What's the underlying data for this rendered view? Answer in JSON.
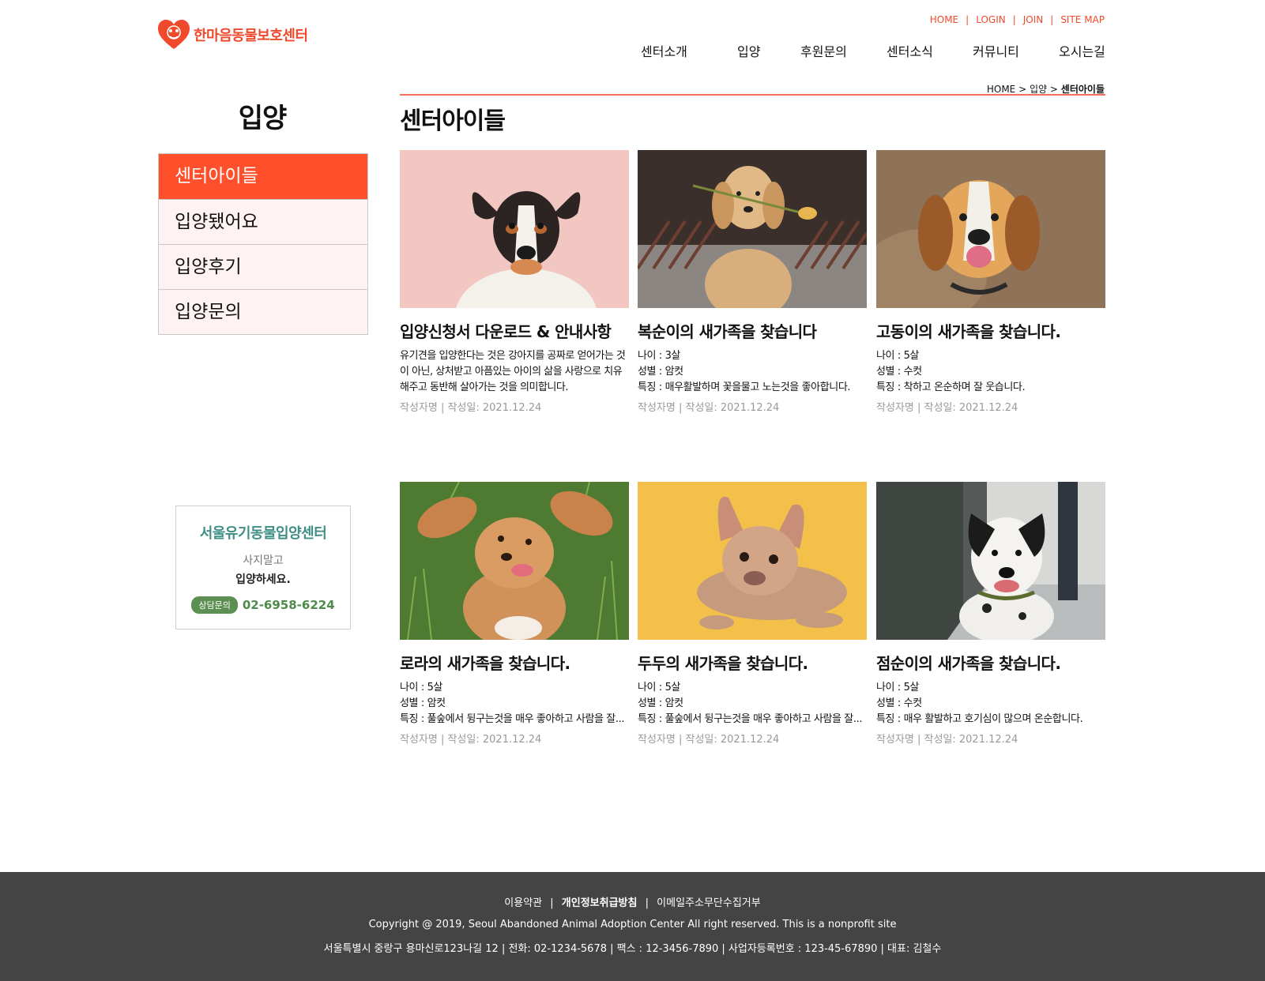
{
  "brand": {
    "name": "한마음동물보호센터",
    "color": "#f0492c",
    "logo_icon": "heart-paw-logo"
  },
  "util_nav": [
    "HOME",
    "LOGIN",
    "JOIN",
    "SITE MAP"
  ],
  "gnb": [
    "센터소개",
    "입양",
    "후원문의",
    "센터소식",
    "커뮤니티",
    "오시는길"
  ],
  "sidebar": {
    "title": "입양",
    "items": [
      {
        "label": "센터아이들",
        "active": true
      },
      {
        "label": "입양됐어요",
        "active": false
      },
      {
        "label": "입양후기",
        "active": false
      },
      {
        "label": "입양문의",
        "active": false
      }
    ],
    "accent": "#ff4f2b"
  },
  "promo": {
    "title": "서울유기동물입양센터",
    "sub1": "사지말고",
    "sub2": "입양하세요.",
    "badge": "상담문의",
    "phone": "02-6958-6224"
  },
  "breadcrumb": {
    "home": "HOME",
    "parent": "입양",
    "current": "센터아이들",
    "sep": ">"
  },
  "page_title": "센터아이들",
  "cards": [
    {
      "title": "입양신청서 다운로드 & 안내사항",
      "desc": "유기견을 입양한다는 것은 강아지를 공짜로 얻어가는 것이 아닌, 상처받고 아픔있는 아이의 삶을 사랑으로 치유해주고 동반해 살아가는 것을 의미합니다.",
      "meta": "작성자명 | 작성일: 2021.12.24",
      "image": "jack-russell-pink-background"
    },
    {
      "title": "복순이의 새가족을 찾습니다",
      "lines": [
        "나이 : 3살",
        "성별 : 암컷",
        "특징 : 매우활발하며 꽃을물고 노는것을 좋아합니다."
      ],
      "meta": "작성자명 | 작성일: 2021.12.24",
      "image": "golden-dog-with-flower"
    },
    {
      "title": "고동이의 새가족을 찾습니다.",
      "lines": [
        "나이 : 5살",
        "성별 : 수컷",
        "특징 : 착하고 온순하며 잘 웃습니다."
      ],
      "meta": "작성자명 | 작성일: 2021.12.24",
      "image": "smiling-beagle"
    },
    {
      "title": "로라의 새가족을 찾습니다.",
      "lines": [
        "나이 : 5살",
        "성별 : 암컷",
        "특징 : 풀숲에서 뒹구는것을 매우 좋아하고 사람을 잘..."
      ],
      "meta": "작성자명 | 작성일: 2021.12.24",
      "image": "spaniel-lying-in-grass"
    },
    {
      "title": "두두의 새가족을 찾습니다.",
      "lines": [
        "나이 : 5살",
        "성별 : 암컷",
        "특징 : 풀숲에서 뒹구는것을 매우 좋아하고 사람을 잘..."
      ],
      "meta": "작성자명 | 작성일: 2021.12.24",
      "image": "french-bulldog-yellow-background"
    },
    {
      "title": "점순이의 새가족을 찾습니다.",
      "lines": [
        "나이 : 5살",
        "성별 : 수컷",
        "특징 : 매우 활발하고 호기심이 많으며 온순합니다."
      ],
      "meta": "작성자명 | 작성일: 2021.12.24",
      "image": "spotted-dog-on-sidewalk"
    }
  ],
  "footer": {
    "links": [
      "이용약관",
      "개인정보취급방침",
      "이메일주소무단수집거부"
    ],
    "copyright": "Copyright @ 2019, Seoul Abandoned Animal Adoption Center All right reserved. This is a nonprofit site",
    "address": "서울특별시 중랑구 용마신로123나길 12 |   전화: 02-1234-5678 | 팩스 : 12-3456-7890 | 사업자등록번호 : 123-45-67890 |  대표: 김철수",
    "bg": "#444444"
  }
}
